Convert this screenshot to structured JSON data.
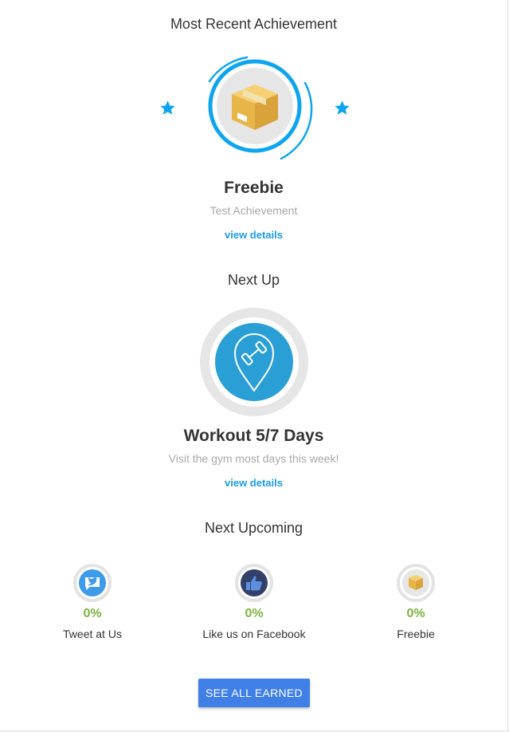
{
  "recent": {
    "heading": "Most Recent Achievement",
    "name": "Freebie",
    "description": "Test Achievement",
    "link": "view details",
    "icon": "package-box-icon",
    "accent": "#0ea5ee"
  },
  "next": {
    "heading": "Next Up",
    "name": "Workout 5/7 Days",
    "description": "Visit the gym most days this week!",
    "link": "view details",
    "icon": "dumbbell-location-pin-icon",
    "progress": 0,
    "badge_color": "#2a9fd6"
  },
  "upcoming": {
    "heading": "Next Upcoming",
    "items": [
      {
        "label": "Tweet at Us",
        "percent": "0%",
        "icon": "twitter-bubble-icon"
      },
      {
        "label": "Like us on Facebook",
        "percent": "0%",
        "icon": "facebook-thumbs-up-icon"
      },
      {
        "label": "Freebie",
        "percent": "0%",
        "icon": "package-box-icon"
      }
    ]
  },
  "actions": {
    "see_all": "SEE ALL EARNED"
  },
  "colors": {
    "link": "#1a9be6",
    "percent": "#7cb342",
    "button": "#3f7fe6",
    "muted": "#a9a9a9"
  }
}
